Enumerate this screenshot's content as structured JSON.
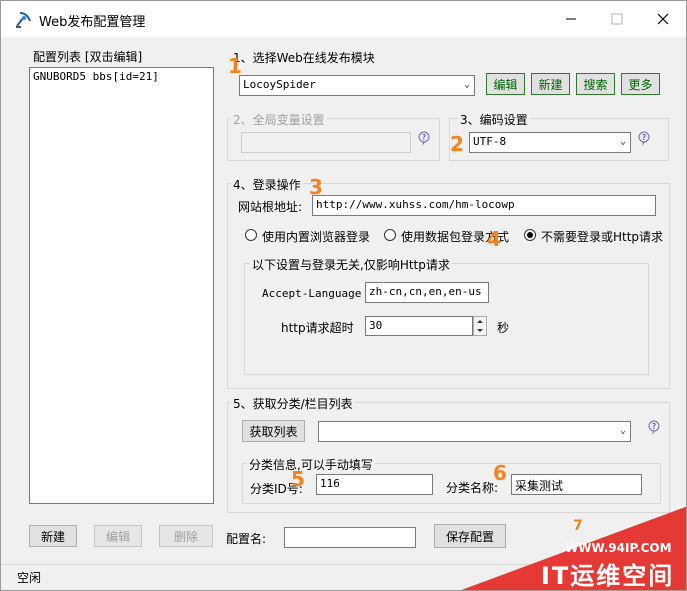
{
  "window": {
    "title": "Web发布配置管理"
  },
  "left": {
    "list_title": "配置列表 [双击编辑]",
    "items": [
      "GNUBORD5 bbs[id=21]"
    ]
  },
  "sec1": {
    "title": "1、选择Web在线发布模块",
    "module": "LocoySpider",
    "edit": "编辑",
    "new": "新建",
    "search": "搜索",
    "more": "更多"
  },
  "sec2": {
    "title": "2、全局变量设置"
  },
  "sec3": {
    "title": "3、编码设置",
    "encoding": "UTF-8"
  },
  "sec4": {
    "title": "4、登录操作",
    "url_label": "网站根地址:",
    "url_value": "http://www.xuhss.com/hm-locowp",
    "opt1": "使用内置浏览器登录",
    "opt2": "使用数据包登录方式",
    "opt3": "不需要登录或Http请求",
    "sub_title": "以下设置与登录无关,仅影响Http请求",
    "accept_label": "Accept-Language",
    "accept_value": "zh-cn,cn,en,en-us",
    "timeout_label": "http请求超时",
    "timeout_value": "30",
    "timeout_unit": "秒"
  },
  "sec5": {
    "title": "5、获取分类/栏目列表",
    "get_button": "获取列表",
    "sub_title": "分类信息,可以手动填写",
    "id_label": "分类ID号:",
    "id_value": "116",
    "name_label": "分类名称:",
    "name_value": "采集测试"
  },
  "bottom": {
    "new": "新建",
    "edit": "编辑",
    "delete": "删除",
    "config_name_label": "配置名:",
    "config_name_value": "",
    "save": "保存配置"
  },
  "status": {
    "text": "空闲"
  },
  "annotations": [
    "1",
    "2",
    "3",
    "4",
    "5",
    "6",
    "7"
  ],
  "watermark": {
    "site": "WWW.94IP.COM",
    "brand": "IT运维空间"
  },
  "colors": {
    "accent": "#f5821f",
    "watermark": "#e53935",
    "green_button": "#006400"
  }
}
